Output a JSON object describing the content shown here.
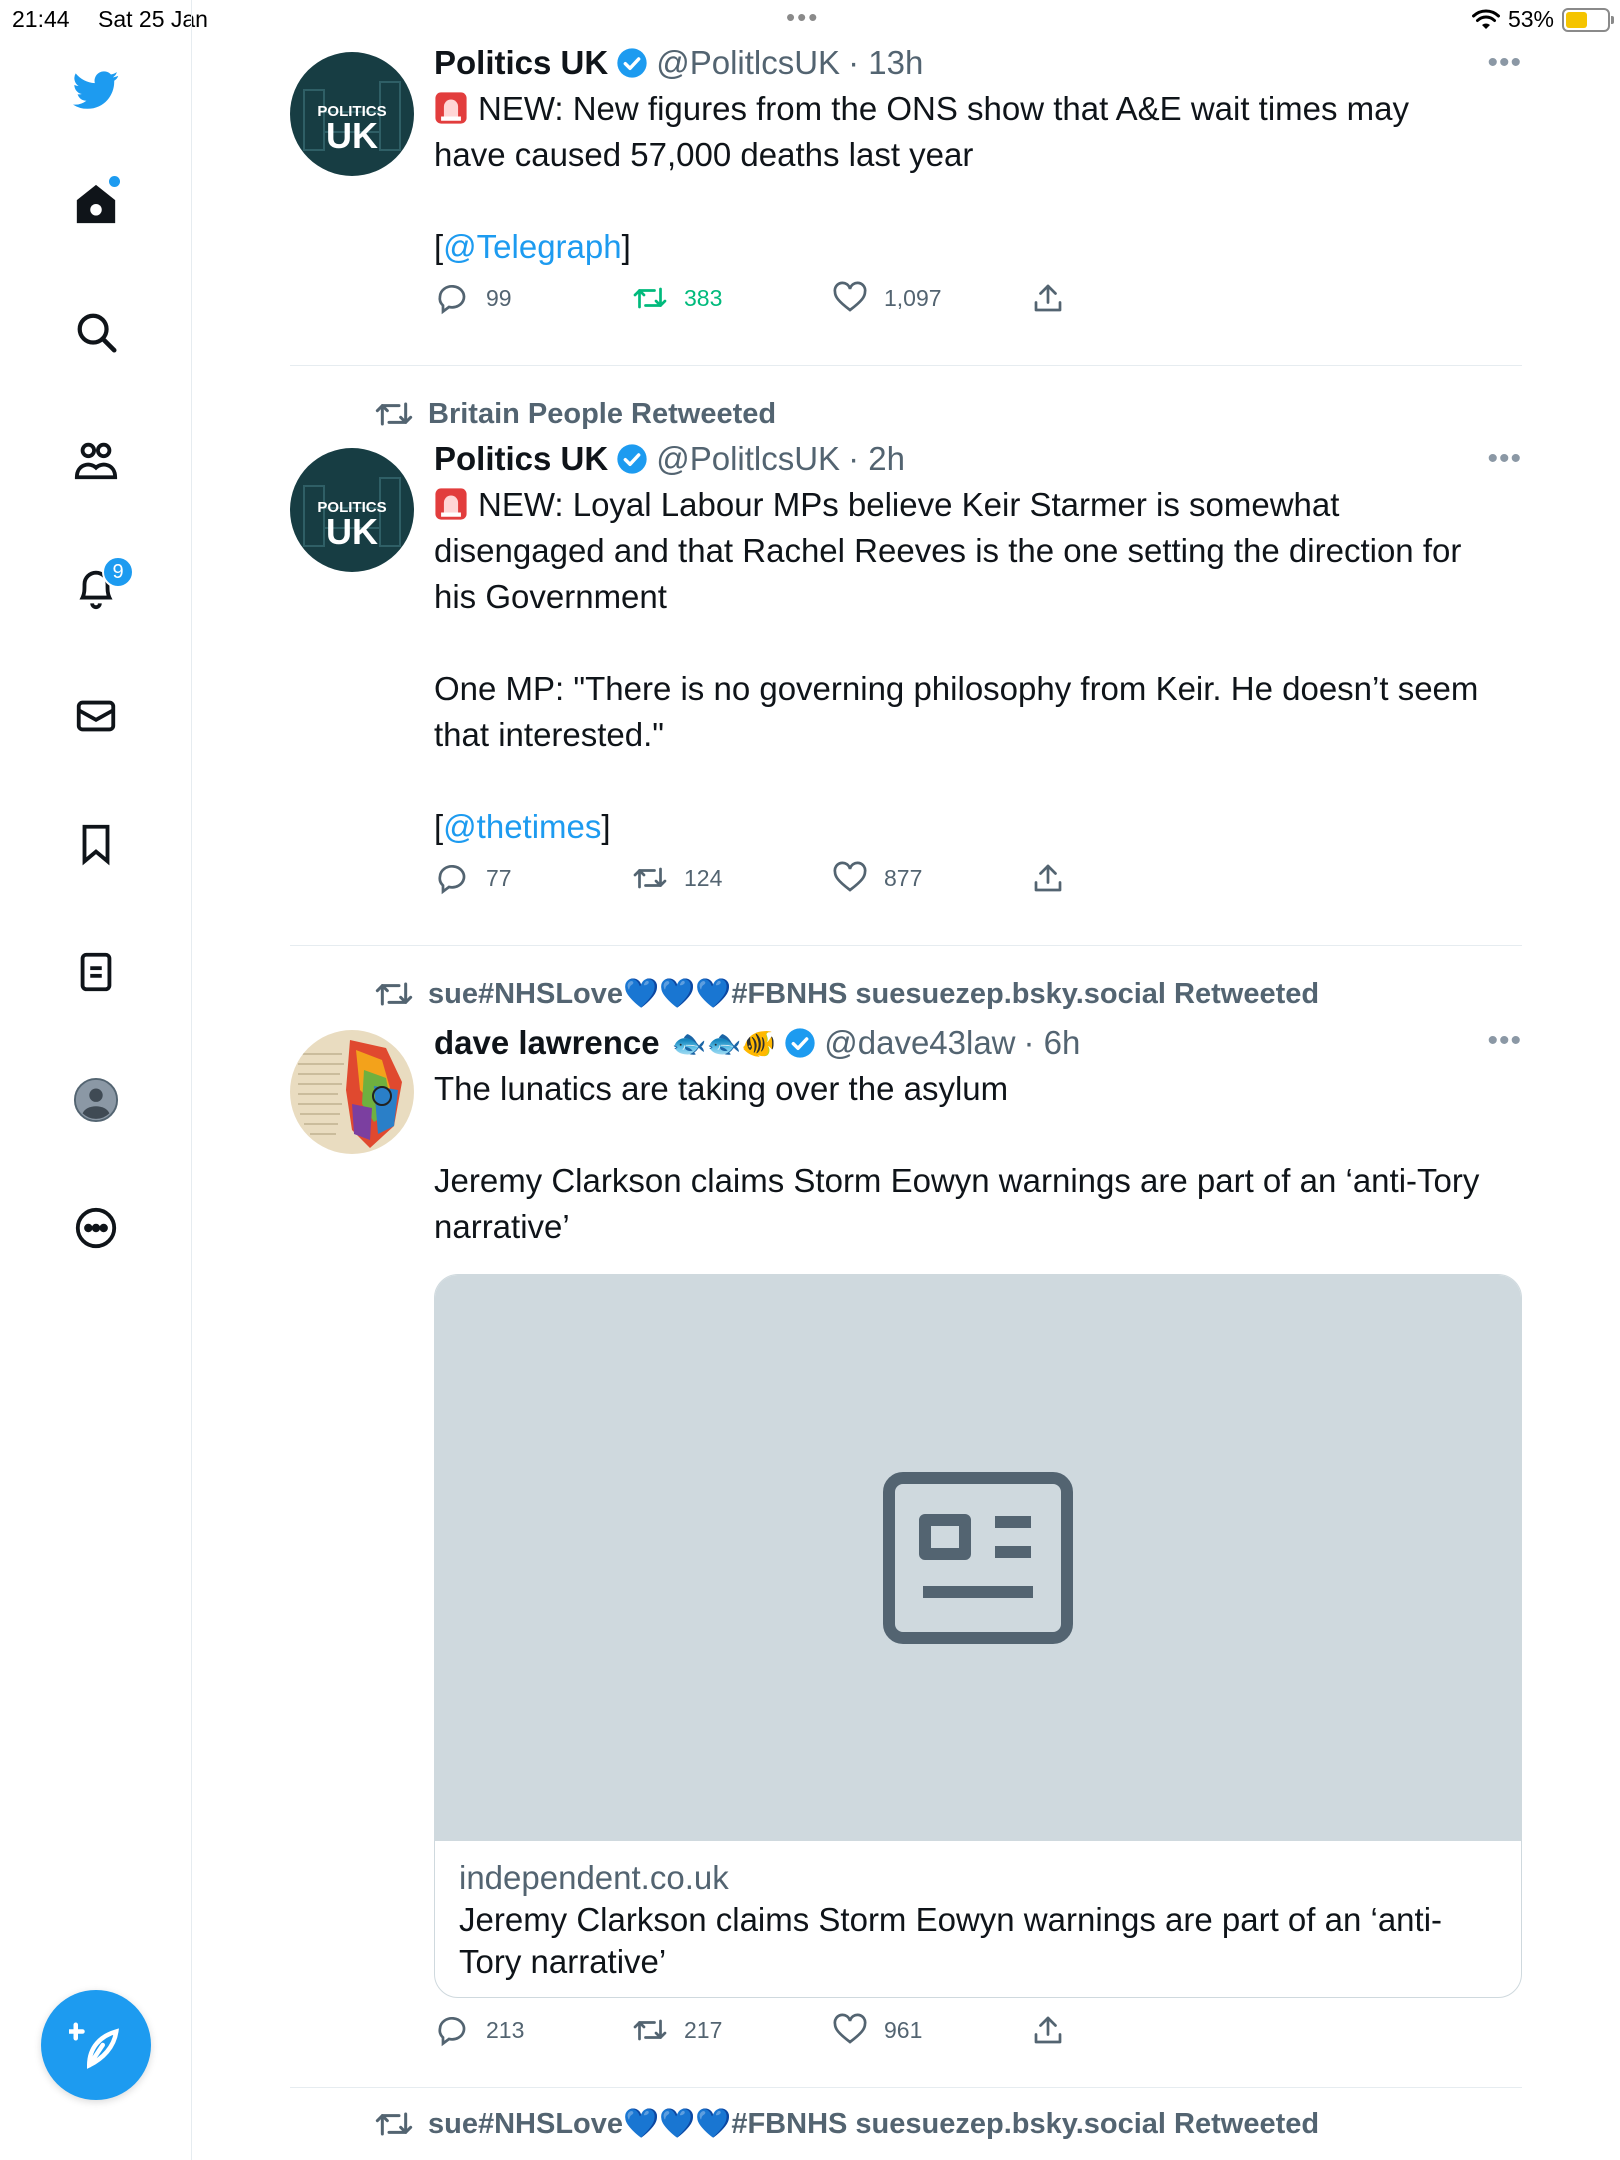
{
  "status_bar": {
    "time": "21:44",
    "date": "Sat 25 Jan",
    "battery": "53%",
    "battery_level": 0.53,
    "more": "•••"
  },
  "sidebar": {
    "notifications_count": "9"
  },
  "tweets": [
    {
      "author_name": "Politics UK",
      "handle": "@PolitlcsUK",
      "time": "· 13h",
      "avatar_line1": "POLITICS",
      "avatar_line2": "UK",
      "text_lines": [
        "NEW: New figures from the ONS show that A&E wait times may",
        "have caused 57,000 deaths last year"
      ],
      "link_prefix": "[",
      "link_text": "@Telegraph",
      "link_suffix": "]",
      "replies": "99",
      "retweets": "383",
      "likes": "1,097",
      "more": "•••"
    },
    {
      "retweeted_by": "Britain People Retweeted",
      "author_name": "Politics UK",
      "handle": "@PolitlcsUK",
      "time": "· 2h",
      "avatar_line1": "POLITICS",
      "avatar_line2": "UK",
      "text_lines": [
        "NEW: Loyal Labour MPs believe Keir Starmer is somewhat",
        "disengaged and that Rachel Reeves is the one setting the direction for",
        "his Government"
      ],
      "quote_lines": [
        "One MP: \"There is no governing philosophy from Keir. He doesn’t seem",
        "that interested.\""
      ],
      "link_prefix": "[",
      "link_text": "@thetimes",
      "link_suffix": "]",
      "replies": "77",
      "retweets": "124",
      "likes": "877",
      "more": "•••"
    },
    {
      "retweeted_by": "sue#NHSLove💙💙💙#FBNHS suesuezep.bsky.social Retweeted",
      "author_name": "dave lawrence",
      "name_emoji": "🐟🐟🐠",
      "handle": "@dave43law",
      "time": "· 6h",
      "text_line1": "The lunatics are taking over the asylum",
      "text_lines2": [
        "Jeremy Clarkson claims Storm Eowyn warnings are part of an ‘anti-Tory",
        "narrative’"
      ],
      "card_domain": "independent.co.uk",
      "card_title_lines": [
        "Jeremy Clarkson claims Storm Eowyn warnings are part of an ‘anti-",
        "Tory narrative’"
      ],
      "replies": "213",
      "retweets": "217",
      "likes": "961",
      "more": "•••"
    },
    {
      "retweeted_by": "sue#NHSLove💙💙💙#FBNHS suesuezep.bsky.social Retweeted"
    }
  ]
}
